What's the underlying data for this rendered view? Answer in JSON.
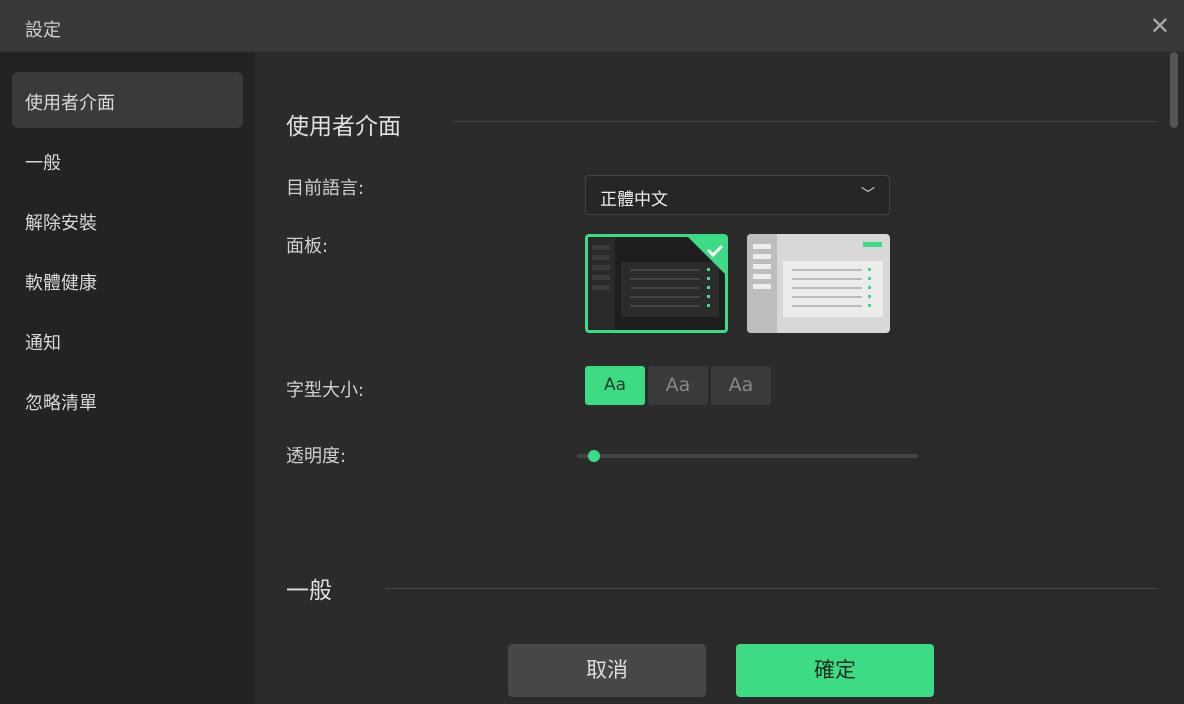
{
  "window": {
    "title": "設定",
    "close_icon": "close-icon"
  },
  "sidebar": {
    "items": [
      {
        "label": "使用者介面",
        "active": true
      },
      {
        "label": "一般"
      },
      {
        "label": "解除安裝"
      },
      {
        "label": "軟體健康"
      },
      {
        "label": "通知"
      },
      {
        "label": "忽略清單"
      }
    ]
  },
  "main": {
    "section_ui": "使用者介面",
    "language_label": "目前語言:",
    "language_value": "正體中文",
    "panel_label": "面板:",
    "panel_selected": "dark",
    "font_size_label": "字型大小:",
    "font_sizes": [
      "Aa",
      "Aa",
      "Aa"
    ],
    "font_size_selected": 0,
    "opacity_label": "透明度:",
    "opacity_value": 0.05,
    "section_general": "一般"
  },
  "footer": {
    "cancel": "取消",
    "ok": "確定"
  },
  "colors": {
    "accent": "#3ddc84"
  }
}
